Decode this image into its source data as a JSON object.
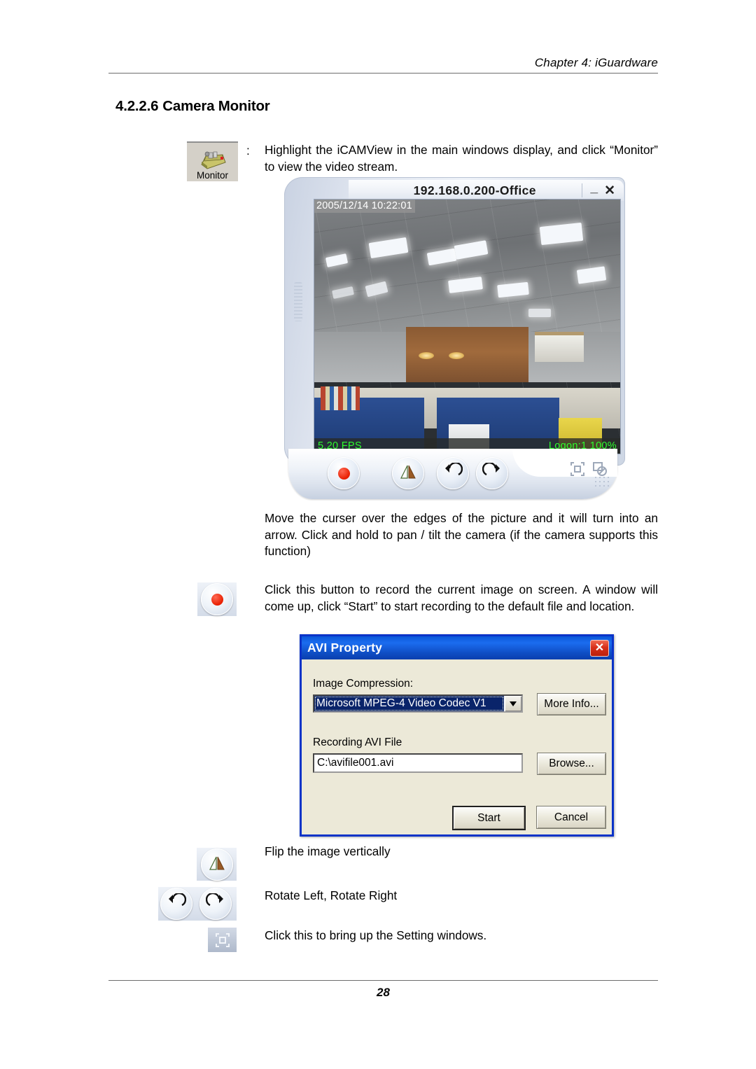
{
  "document": {
    "running_head": "Chapter 4: iGuardware",
    "section_number": "4.2.2.6",
    "section_title": "Camera Monitor",
    "page_number": "28"
  },
  "monitor_button": {
    "label": "Monitor",
    "icon": "monitor-device-icon",
    "colon": ":"
  },
  "instructions": {
    "monitor_text": "Highlight the iCAMView in the main windows display, and click “Monitor” to view the video stream.",
    "pan_tilt_text": "Move the curser over the edges of the picture and it will turn into an arrow.   Click and hold to pan / tilt the camera (if the camera supports this function)",
    "record_text": "Click this button to record the current image on screen. A window will come up, click “Start” to start recording to the default file and location.",
    "flip_text": "Flip the image vertically",
    "rotate_text": "Rotate Left, Rotate Right",
    "setting_text": "Click this to bring up the Setting windows."
  },
  "camera_window": {
    "title": "192.168.0.200-Office",
    "minimize_label": "_",
    "close_label": "✕",
    "timestamp": "2005/12/14 10:22:01",
    "fps": "5.20 FPS",
    "logon": "Logon:1 100%",
    "controls": [
      {
        "name": "record-button",
        "icon": "record-dot-icon"
      },
      {
        "name": "flip-button",
        "icon": "flip-vertical-icon"
      },
      {
        "name": "rotate-left-button",
        "icon": "rotate-left-icon"
      },
      {
        "name": "rotate-right-button",
        "icon": "rotate-right-icon"
      },
      {
        "name": "setting-button",
        "icon": "frame-square-icon"
      },
      {
        "name": "snapshot-button",
        "icon": "copy-window-icon"
      }
    ]
  },
  "avi_dialog": {
    "title": "AVI Property",
    "close_label": "✕",
    "compression_label": "Image Compression:",
    "compression_value": "Microsoft MPEG-4 Video Codec V1",
    "more_info_label": "More Info...",
    "file_label": "Recording AVI File",
    "file_value": "C:\\avifile001.avi",
    "browse_label": "Browse...",
    "start_label": "Start",
    "cancel_label": "Cancel"
  },
  "colors": {
    "title_blue": "#0a3fae",
    "dialog_face": "#ece9d8",
    "selection_blue": "#0a246a",
    "status_green": "#2dfd2d",
    "record_red": "#e81f00"
  }
}
